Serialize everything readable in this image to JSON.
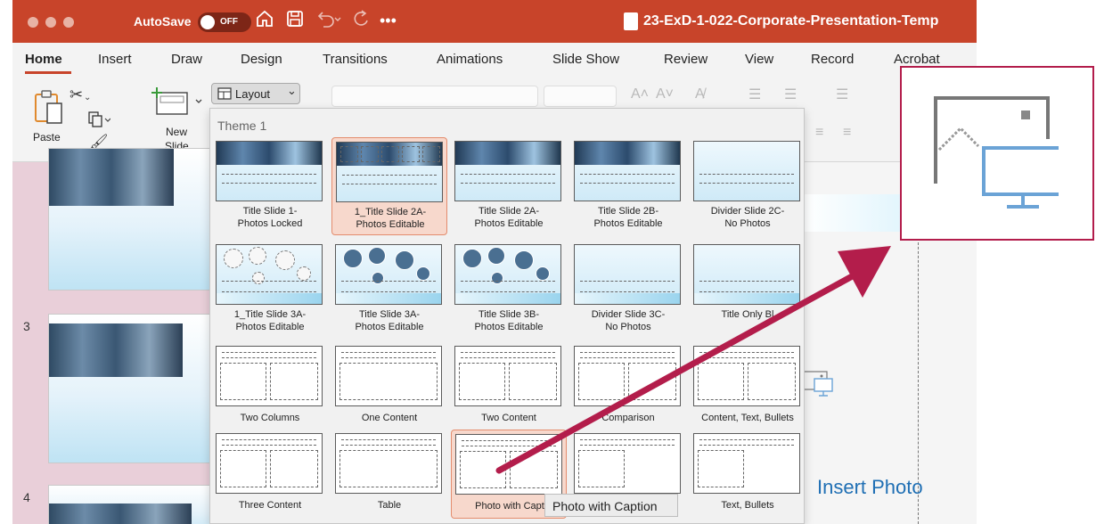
{
  "app": {
    "autosave_label": "AutoSave",
    "autosave_state": "OFF",
    "document_title": "23-ExD-1-022-Corporate-Presentation-Temp",
    "accent": "#c8442a"
  },
  "tabs": [
    "Home",
    "Insert",
    "Draw",
    "Design",
    "Transitions",
    "Animations",
    "Slide Show",
    "Review",
    "View",
    "Record",
    "Acrobat"
  ],
  "ribbon": {
    "paste_label": "Paste",
    "new_slide_label_1": "New",
    "new_slide_label_2": "Slide",
    "layout_label": "Layout",
    "layout_chevron": "⌄"
  },
  "slide_pane": {
    "numbers": [
      "3",
      "4"
    ]
  },
  "gallery": {
    "heading": "Theme 1",
    "selected_index": 1,
    "layouts": [
      {
        "l1": "Title Slide 1-",
        "l2": "Photos Locked"
      },
      {
        "l1": "1_Title Slide 2A-",
        "l2": "Photos Editable"
      },
      {
        "l1": "Title Slide 2A-",
        "l2": "Photos Editable"
      },
      {
        "l1": "Title Slide 2B-",
        "l2": "Photos Editable"
      },
      {
        "l1": "Divider Slide 2C-",
        "l2": "No Photos"
      },
      {
        "l1": "1_Title Slide 3A-",
        "l2": "Photos Editable"
      },
      {
        "l1": "Title Slide 3A-",
        "l2": "Photos Editable"
      },
      {
        "l1": "Title Slide 3B-",
        "l2": "Photos Editable"
      },
      {
        "l1": "Divider Slide 3C-",
        "l2": "No Photos"
      },
      {
        "l1": "Title Only Bl",
        "l2": ""
      },
      {
        "l1": "Two Columns",
        "l2": ""
      },
      {
        "l1": "One Content",
        "l2": ""
      },
      {
        "l1": "Two Content",
        "l2": ""
      },
      {
        "l1": "Comparison",
        "l2": ""
      },
      {
        "l1": "Content, Text, Bullets",
        "l2": ""
      },
      {
        "l1": "Three Content",
        "l2": ""
      },
      {
        "l1": "Table",
        "l2": ""
      },
      {
        "l1": "Photo with Capt",
        "l2": ""
      },
      {
        "l1": "",
        "l2": ""
      },
      {
        "l1": "Text, Bullets",
        "l2": ""
      }
    ],
    "hovered_index": 17,
    "tooltip": "Photo with Caption"
  },
  "slide": {
    "insert_photo_label": "Insert Photo"
  },
  "colors": {
    "callout_border": "#b31d4b",
    "arrow": "#b31d4b",
    "photo_icon_blue": "#6ba3d6"
  },
  "icons": [
    "apple-traffic-lights",
    "home-icon",
    "save-icon",
    "undo-icon",
    "redo-icon",
    "more-icon",
    "paste-icon",
    "cut-icon",
    "copy-icon",
    "format-painter-icon",
    "new-slide-icon",
    "layout-icon",
    "insert-picture-icon"
  ]
}
